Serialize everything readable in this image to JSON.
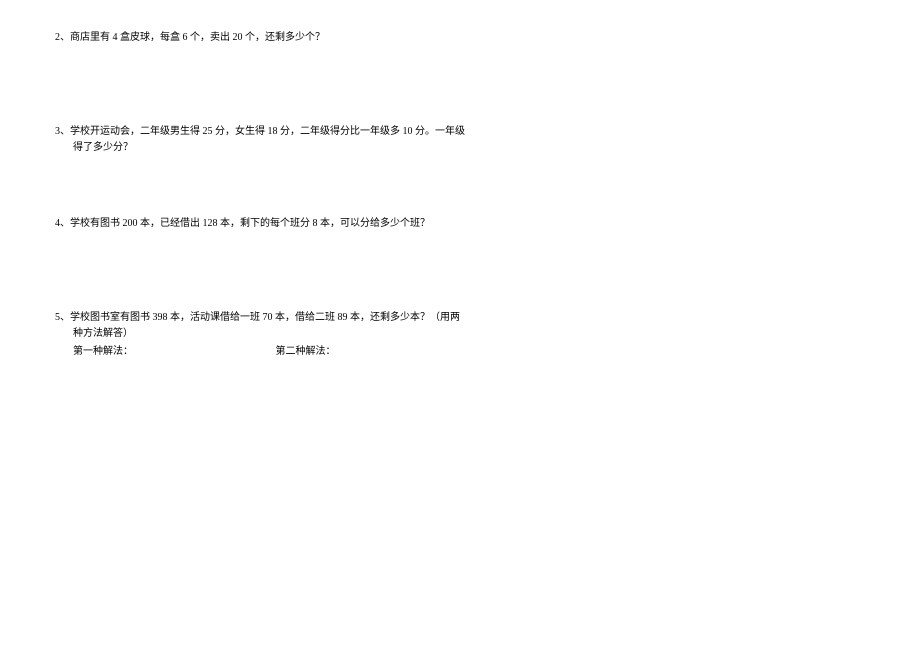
{
  "questions": [
    {
      "num": "2、",
      "text": "商店里有 4 盒皮球，每盒 6 个，卖出 20 个，还剩多少个？"
    },
    {
      "num": "3、",
      "text_line1": "学校开运动会，二年级男生得 25 分，女生得 18 分，二年级得分比一年级多 10 分。一年级",
      "text_line2": "得了多少分？"
    },
    {
      "num": "4、",
      "text": "学校有图书 200 本，已经借出 128 本，剩下的每个班分 8 本，可以分给多少个班？"
    },
    {
      "num": "5、",
      "text_line1": "学校图书室有图书 398 本，活动课借给一班 70 本，借给二班 89 本，还剩多少本？（用两",
      "text_line2": "种方法解答）",
      "method1": "第一种解法：",
      "method2": "第二种解法："
    }
  ]
}
